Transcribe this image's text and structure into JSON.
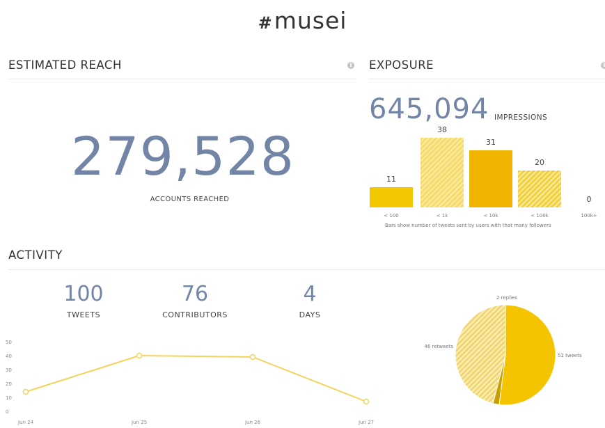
{
  "header": {
    "hash": "#",
    "tag": "musei"
  },
  "reach": {
    "title": "ESTIMATED REACH",
    "value": "279,528",
    "label": "ACCOUNTS REACHED",
    "info_icon": "info-icon"
  },
  "exposure": {
    "title": "EXPOSURE",
    "value": "645,094",
    "unit": "IMPRESSIONS",
    "note": "Bars show number of tweets sent by users with that many followers",
    "info_icon": "info-icon",
    "chart_data": {
      "type": "bar",
      "categories": [
        "< 100",
        "< 1k",
        "< 10k",
        "< 100k",
        "100k+"
      ],
      "values": [
        11,
        38,
        31,
        20,
        0
      ],
      "colors": [
        "#f2c700",
        "#f5dc6a",
        "#f0b400",
        "#f1d03a",
        "#f2c700"
      ],
      "hatched": [
        false,
        true,
        false,
        true,
        false
      ]
    }
  },
  "activity": {
    "title": "ACTIVITY",
    "tweets": {
      "value": "100",
      "label": "TWEETS"
    },
    "contributors": {
      "value": "76",
      "label": "CONTRIBUTORS"
    },
    "days": {
      "value": "4",
      "label": "DAYS"
    },
    "line_chart": {
      "type": "line",
      "x": [
        "Jun 24",
        "Jun 25",
        "Jun 26",
        "Jun 27"
      ],
      "values": [
        14,
        40,
        39,
        7
      ],
      "ylim": [
        0,
        50
      ],
      "yticks": [
        "50",
        "40",
        "30",
        "20",
        "10",
        "0"
      ],
      "color": "#f3d35c"
    },
    "pie_chart": {
      "type": "pie",
      "slices": [
        {
          "label": "52 tweets",
          "value": 52,
          "color": "#f5c400"
        },
        {
          "label": "2 replies",
          "value": 2,
          "color": "#c9a000"
        },
        {
          "label": "46 retweets",
          "value": 46,
          "color": "#f6e08a"
        }
      ]
    }
  }
}
